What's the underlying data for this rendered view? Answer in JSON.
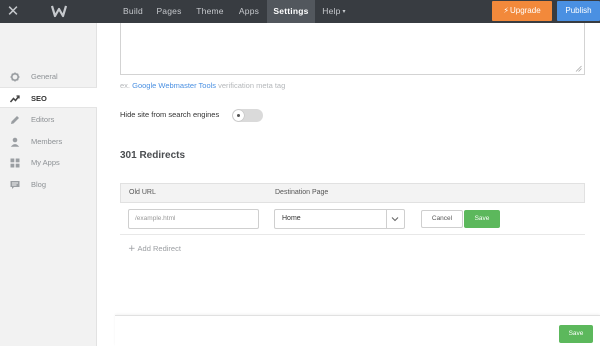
{
  "topbar": {
    "nav": [
      {
        "label": "Build"
      },
      {
        "label": "Pages"
      },
      {
        "label": "Theme"
      },
      {
        "label": "Apps"
      },
      {
        "label": "Settings",
        "active": true
      },
      {
        "label": "Help"
      }
    ],
    "upgrade_label": "Upgrade",
    "publish_label": "Publish"
  },
  "sidebar": {
    "items": [
      {
        "label": "General",
        "icon": "gear-icon"
      },
      {
        "label": "SEO",
        "icon": "trend-icon",
        "active": true
      },
      {
        "label": "Editors",
        "icon": "pencil-icon"
      },
      {
        "label": "Members",
        "icon": "person-icon"
      },
      {
        "label": "My Apps",
        "icon": "grid-icon"
      },
      {
        "label": "Blog",
        "icon": "chat-icon"
      }
    ]
  },
  "seo": {
    "hint_prefix": "ex.",
    "hint_link": "Google Webmaster Tools",
    "hint_suffix": "verification meta tag",
    "hide_label": "Hide site from search engines",
    "hide_enabled": false
  },
  "redirects": {
    "title": "301 Redirects",
    "col_old": "Old URL",
    "col_dest": "Destination Page",
    "row": {
      "old_url_placeholder": "/example.html",
      "destination": "Home",
      "cancel_label": "Cancel",
      "save_label": "Save"
    },
    "add_label": "Add Redirect"
  },
  "footer": {
    "save_label": "Save"
  },
  "colors": {
    "topbar": "#383c41",
    "upgrade": "#f2893b",
    "publish": "#4a90e2",
    "save": "#5cb85c",
    "link": "#4a90e2"
  }
}
